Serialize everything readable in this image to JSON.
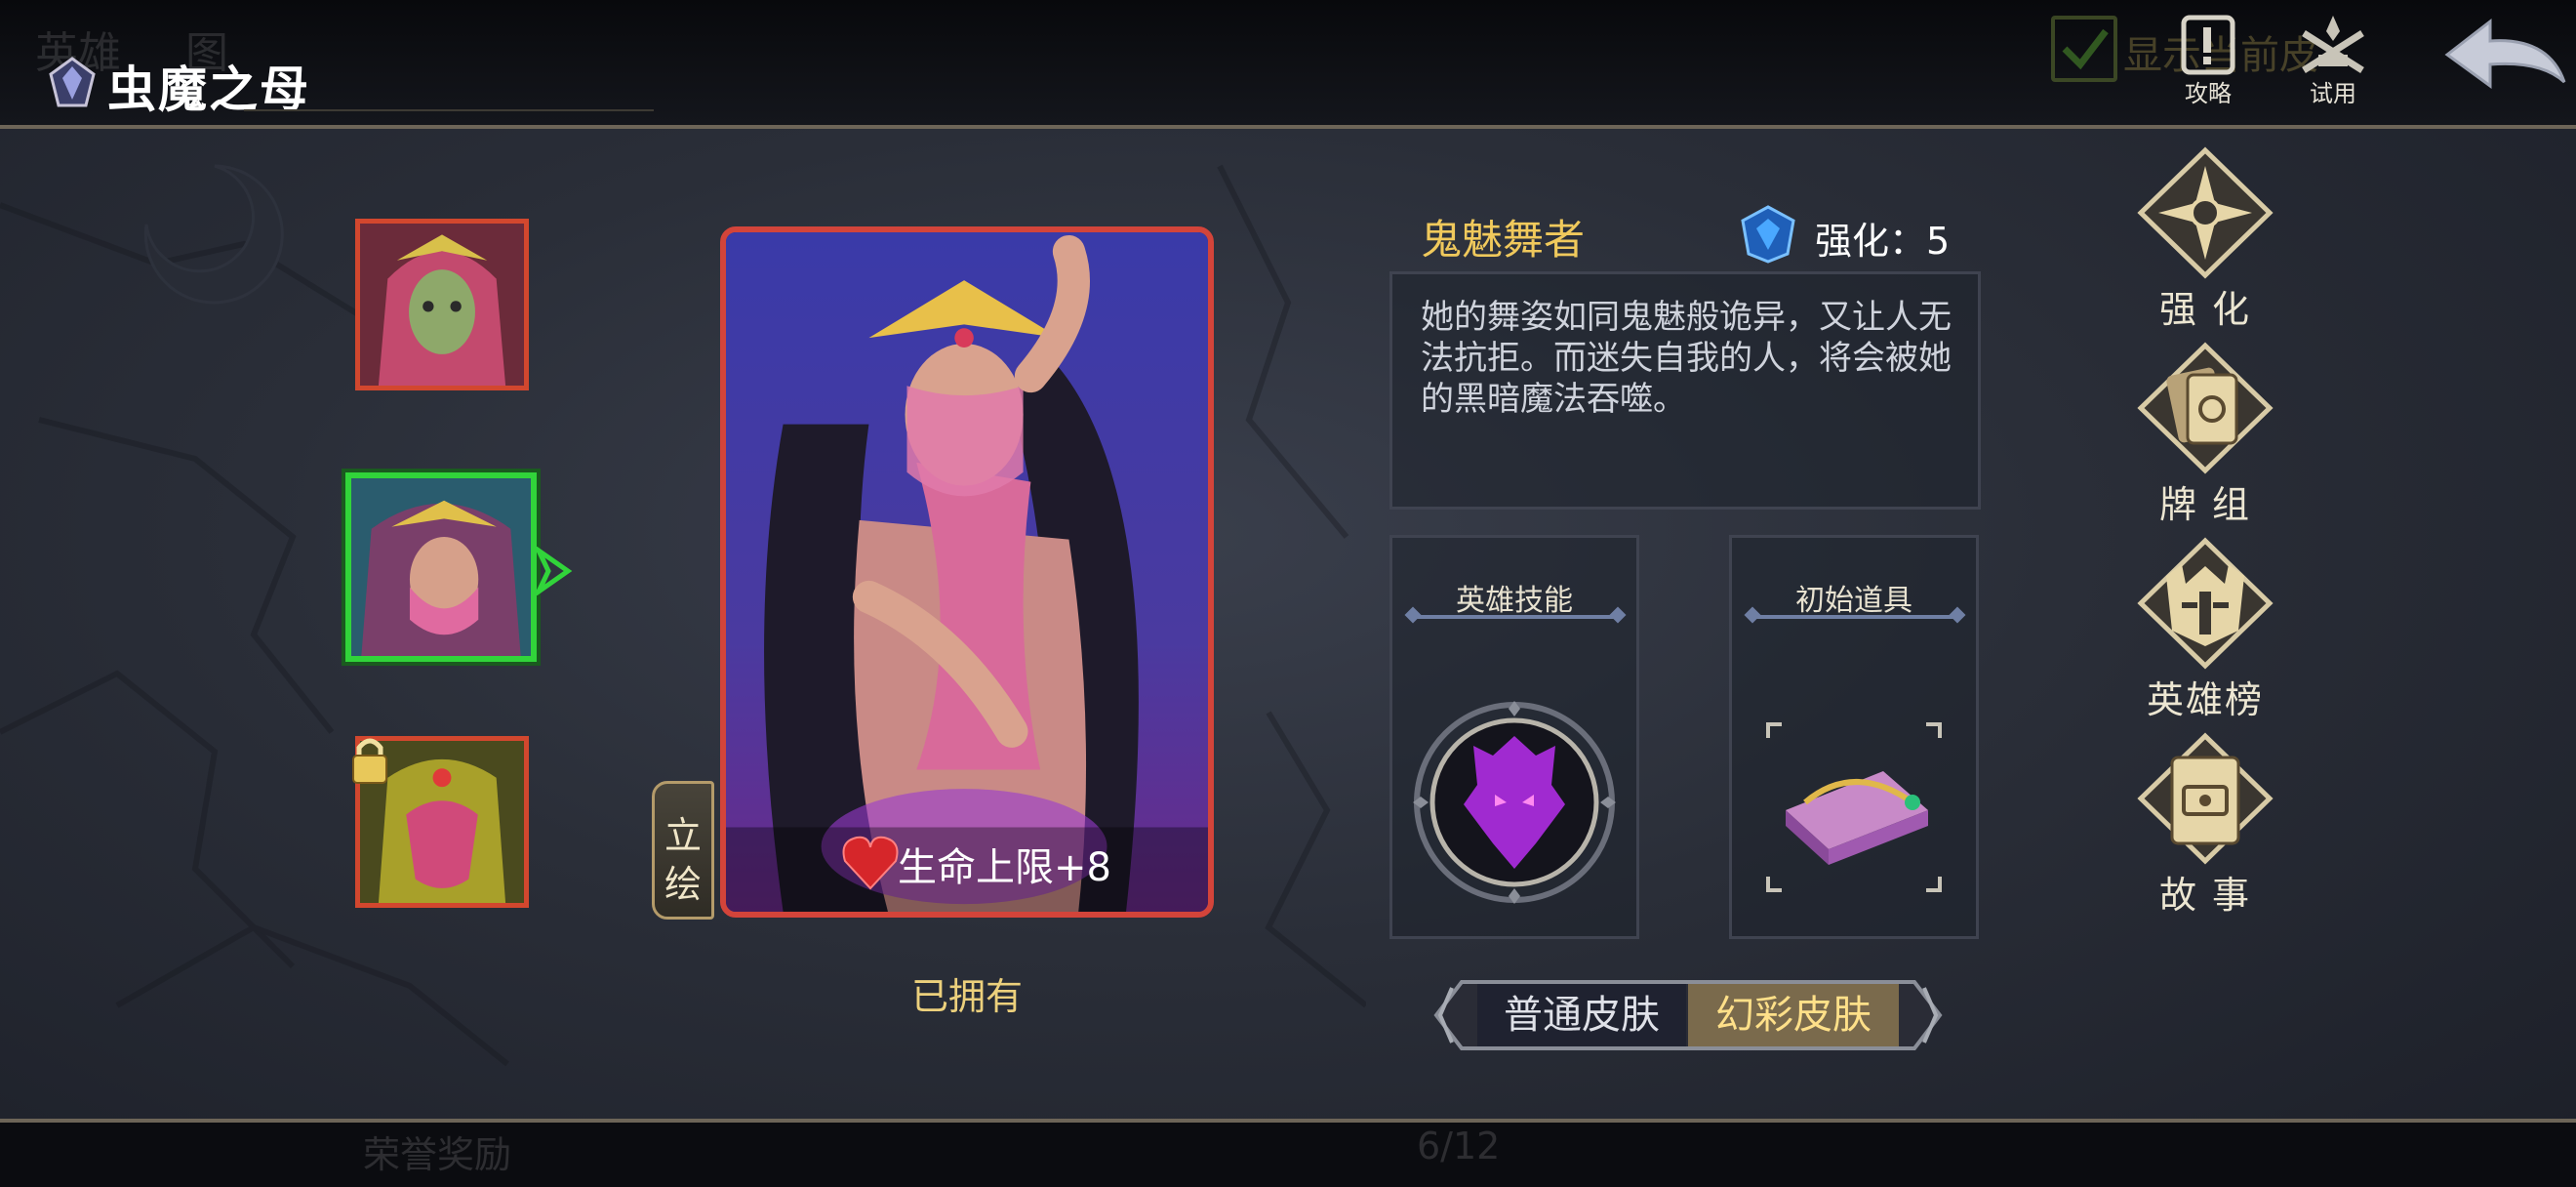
{
  "header": {
    "title": "虫魔之母",
    "ghost_tab_1": "英雄",
    "ghost_tab_2": "图",
    "ghost_checkbox_text": "显示当前皮",
    "strategy_label": "攻略",
    "trial_label": "试用"
  },
  "portraits": [
    {
      "name": "hero-skin-1",
      "state": "normal"
    },
    {
      "name": "hero-skin-2",
      "state": "selected"
    },
    {
      "name": "hero-skin-3",
      "state": "locked"
    }
  ],
  "card": {
    "vertical_tab_label": [
      "立",
      "绘"
    ],
    "bonus_text": "生命上限+8",
    "owned_text": "已拥有"
  },
  "info": {
    "skin_name": "鬼魅舞者",
    "enhance_text": "强化：5",
    "description": "她的舞姿如同鬼魅般诡异，又让人无法抗拒。而迷失自我的人，将会被她的黑暗魔法吞噬。",
    "skill_title": "英雄技能",
    "item_title": "初始道具"
  },
  "skin_toggle": {
    "normal": "普通皮肤",
    "fantasy": "幻彩皮肤",
    "selected": "fantasy"
  },
  "right_menu": [
    {
      "label": "强 化",
      "icon": "compass-star-icon"
    },
    {
      "label": "牌 组",
      "icon": "card-deck-icon"
    },
    {
      "label": "英雄榜",
      "icon": "helmet-icon"
    },
    {
      "label": "故 事",
      "icon": "book-icon"
    }
  ],
  "footer": {
    "ghost_reward": "荣誉奖励",
    "ghost_page": "6/12"
  },
  "colors": {
    "accent_gold": "#f0c95c",
    "frame_red": "#d3443a",
    "select_green": "#31d43a"
  }
}
